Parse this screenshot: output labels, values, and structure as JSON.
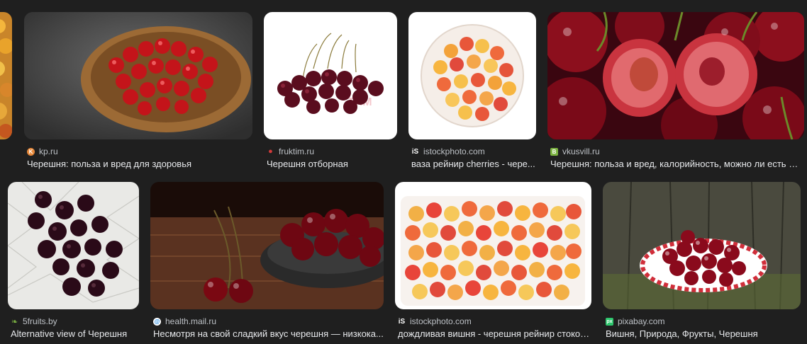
{
  "row1": [
    {
      "source": "",
      "title": "",
      "favicon_icon": "none"
    },
    {
      "source": "kp.ru",
      "title": "Черешня: польза и вред для здоровья",
      "favicon_icon": "kp-favicon-icon",
      "favicon_color": "#e8893a"
    },
    {
      "source": "fruktim.ru",
      "title": "Черешня отборная",
      "favicon_icon": "cherry-favicon-icon",
      "favicon_color": "#d33a3a"
    },
    {
      "source": "istockphoto.com",
      "title": "ваза рейнир cherries - чере...",
      "favicon_icon": "istock-favicon-icon",
      "favicon_color": "#ffffff"
    },
    {
      "source": "vkusvill.ru",
      "title": "Черешня: польза и вред, калорийность, можно ли есть пр...",
      "favicon_icon": "vkusvill-favicon-icon",
      "favicon_color": "#7cb342"
    }
  ],
  "row2": [
    {
      "source": "5fruits.by",
      "title": "Alternative view of Черешня",
      "favicon_icon": "fruit-favicon-icon",
      "favicon_color": "#7cb342"
    },
    {
      "source": "health.mail.ru",
      "title": "Несмотря на свой сладкий вкус черешня — низкока...",
      "favicon_icon": "mail-favicon-icon",
      "favicon_color": "#1e88e5"
    },
    {
      "source": "istockphoto.com",
      "title": "дождливая вишня - черешня рейнир стоков...",
      "favicon_icon": "istock-favicon-icon",
      "favicon_color": "#ffffff"
    },
    {
      "source": "pixabay.com",
      "title": "Вишня, Природа, Фрукты, Черешня",
      "favicon_icon": "pixabay-favicon-icon",
      "favicon_color": "#2ec66d"
    }
  ],
  "favicon_glyphs": {
    "kp": "K",
    "fruktim": "●",
    "istock": "iS",
    "vkusvill": "B",
    "fivefruits": "❧",
    "mail": "@",
    "pixabay": "px"
  }
}
